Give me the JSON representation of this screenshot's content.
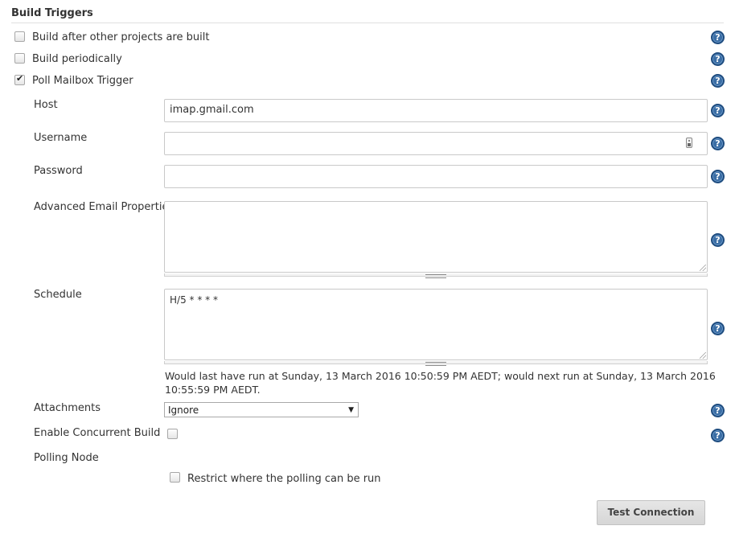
{
  "section": {
    "title": "Build Triggers"
  },
  "triggers": [
    {
      "label": "Build after other projects are built",
      "checked": false
    },
    {
      "label": "Build periodically",
      "checked": false
    },
    {
      "label": "Poll Mailbox Trigger",
      "checked": true
    }
  ],
  "poll_mailbox": {
    "host": {
      "label": "Host",
      "value": "imap.gmail.com"
    },
    "username": {
      "label": "Username",
      "value": ""
    },
    "password": {
      "label": "Password",
      "value": ""
    },
    "advanced": {
      "label": "Advanced Email Properties",
      "value": ""
    },
    "schedule": {
      "label": "Schedule",
      "value": "H/5 * * * *",
      "note_line1": "Would last have run at Sunday, 13 March 2016 10:50:59 PM AEDT; would next run at Sunday, 13 March 2016",
      "note_line2": "10:55:59 PM AEDT."
    },
    "attachments": {
      "label": "Attachments",
      "selected": "Ignore",
      "arrow": "▼"
    },
    "concurrent": {
      "label": "Enable Concurrent Build",
      "checked": false
    },
    "polling_node": {
      "label": "Polling Node",
      "restrict_label": "Restrict where the polling can be run",
      "checked": false
    },
    "test_button": "Test Connection"
  },
  "help_glyph": "?",
  "icons": {
    "help": "help-icon",
    "credentials": "credentials-key-icon",
    "checkmark": "checkmark-icon"
  },
  "colors": {
    "help_blue": "#3b6ea5",
    "text": "#333333",
    "button_bg": "#dcdcdc"
  }
}
